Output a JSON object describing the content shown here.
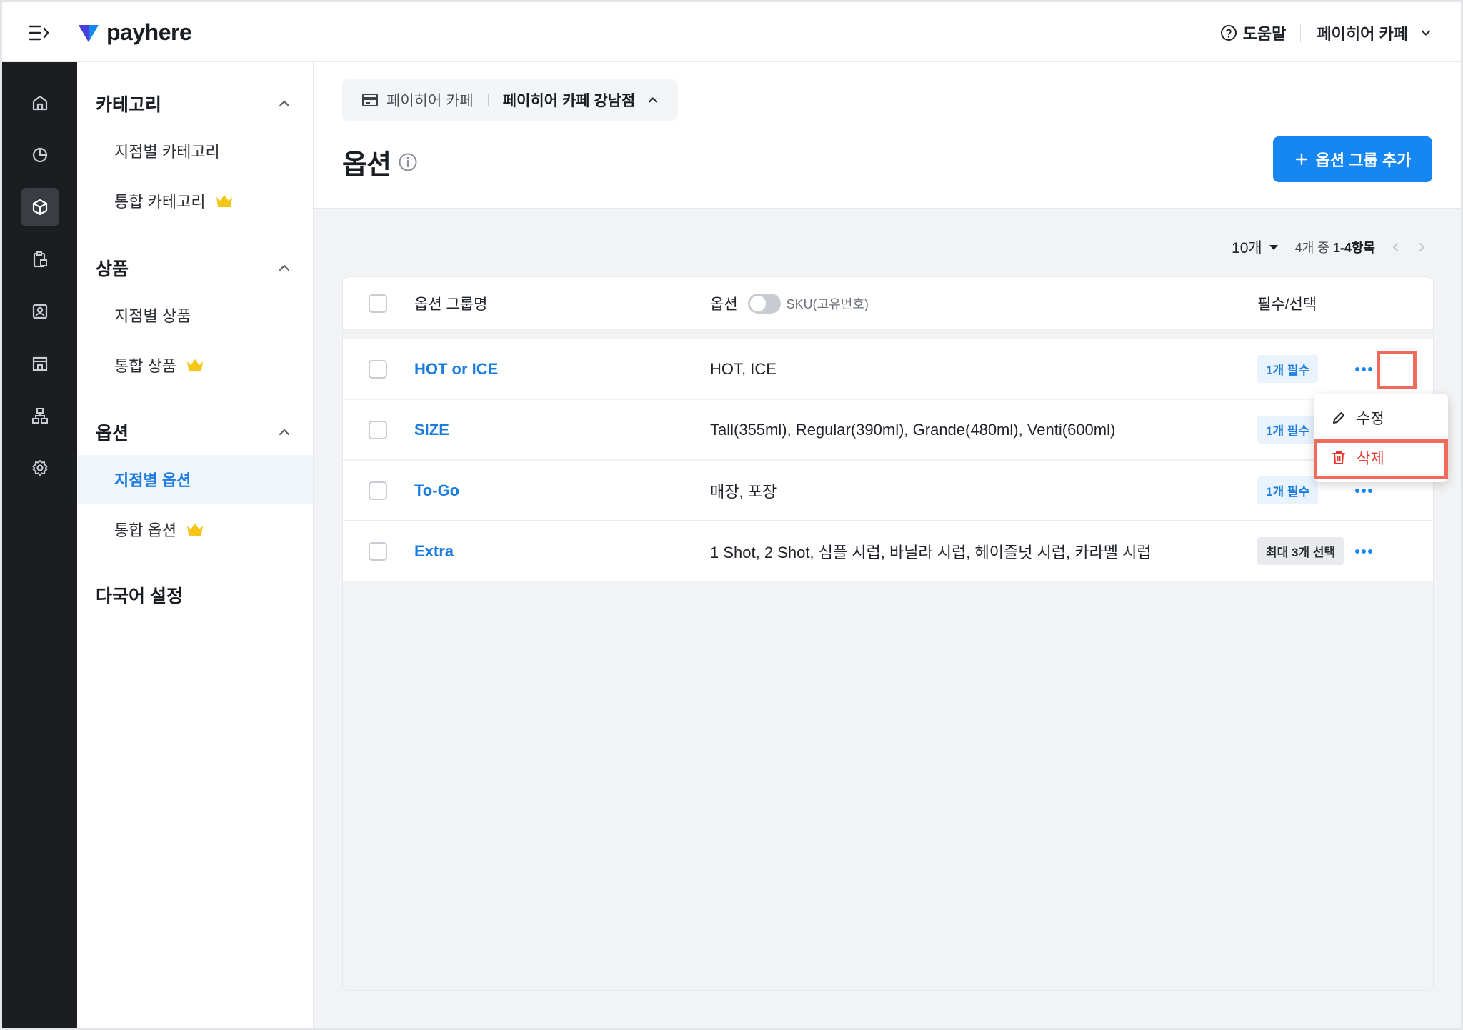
{
  "header": {
    "logo_text": "payhere",
    "help_label": "도움말",
    "store_name": "페이히어 카페"
  },
  "rail": {
    "items": [
      "home-icon",
      "chart-pie-icon",
      "box-icon",
      "clipboard-icon",
      "user-card-icon",
      "store-icon",
      "org-tree-icon",
      "gear-icon"
    ],
    "active_index": 2
  },
  "sidebar": {
    "groups": [
      {
        "label": "카테고리",
        "items": [
          {
            "label": "지점별 카테고리",
            "premium": false
          },
          {
            "label": "통합 카테고리",
            "premium": true
          }
        ]
      },
      {
        "label": "상품",
        "items": [
          {
            "label": "지점별 상품",
            "premium": false
          },
          {
            "label": "통합 상품",
            "premium": true
          }
        ]
      },
      {
        "label": "옵션",
        "items": [
          {
            "label": "지점별 옵션",
            "premium": false,
            "active": true
          },
          {
            "label": "통합 옵션",
            "premium": true
          }
        ]
      }
    ],
    "extra": {
      "label": "다국어 설정"
    }
  },
  "breadcrumb": {
    "store": "페이히어 카페",
    "branch": "페이히어 카페 강남점"
  },
  "page": {
    "title": "옵션",
    "add_button": "옵션 그룹 추가"
  },
  "pager": {
    "page_size": "10개",
    "info_prefix": "4개 중",
    "info_range": "1-4항목"
  },
  "table": {
    "headers": {
      "name": "옵션 그룹명",
      "options": "옵션",
      "sku_toggle": "SKU(고유번호)",
      "required": "필수/선택"
    },
    "rows": [
      {
        "name": "HOT or ICE",
        "options": "HOT, ICE",
        "badge": "1개 필수",
        "badge_type": "blue"
      },
      {
        "name": "SIZE",
        "options": "Tall(355ml), Regular(390ml), Grande(480ml), Venti(600ml)",
        "badge": "1개 필수",
        "badge_type": "blue"
      },
      {
        "name": "To-Go",
        "options": "매장, 포장",
        "badge": "1개 필수",
        "badge_type": "blue"
      },
      {
        "name": "Extra",
        "options": "1 Shot, 2 Shot, 심플 시럽, 바닐라 시럽, 헤이즐넛 시럽, 카라멜 시럽",
        "badge": "최대 3개 선택",
        "badge_type": "gray"
      }
    ]
  },
  "row_menu": {
    "edit": "수정",
    "delete": "삭제"
  },
  "colors": {
    "brand_blue": "#1687f2",
    "link_blue": "#1a7cde",
    "danger_red": "#e5342b",
    "highlight": "#f06a5e",
    "rail_bg": "#1b1d21"
  }
}
